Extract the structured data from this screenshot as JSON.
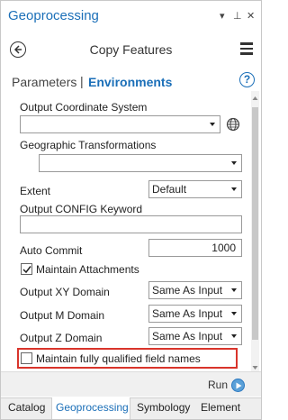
{
  "window": {
    "title": "Geoprocessing",
    "dropdown_glyph": "▾",
    "pin_glyph": "⊥",
    "close_glyph": "✕"
  },
  "header": {
    "tool_title": "Copy Features"
  },
  "tabs": {
    "parameters": "Parameters",
    "separator": "|",
    "environments": "Environments",
    "help": "?"
  },
  "env": {
    "output_coordinate_system": {
      "label": "Output Coordinate System",
      "value": ""
    },
    "geographic_transformations": {
      "label": "Geographic Transformations",
      "value": ""
    },
    "extent": {
      "label": "Extent",
      "value": "Default"
    },
    "output_config_keyword": {
      "label": "Output CONFIG Keyword",
      "value": ""
    },
    "auto_commit": {
      "label": "Auto Commit",
      "value": "1000"
    },
    "maintain_attachments": {
      "label": "Maintain Attachments",
      "checked": true
    },
    "output_xy_domain": {
      "label": "Output XY Domain",
      "value": "Same As Input"
    },
    "output_m_domain": {
      "label": "Output M Domain",
      "value": "Same As Input"
    },
    "output_z_domain": {
      "label": "Output Z Domain",
      "value": "Same As Input"
    },
    "maintain_fully_qualified": {
      "label": "Maintain fully qualified field names",
      "checked": false
    }
  },
  "footer": {
    "run_label": "Run"
  },
  "bottom_tabs": [
    {
      "label": "Catalog",
      "active": false
    },
    {
      "label": "Geoprocessing",
      "active": true
    },
    {
      "label": "Symbology",
      "active": false
    },
    {
      "label": "Element",
      "active": false
    }
  ],
  "colors": {
    "accent": "#1b6fb8",
    "highlight_border": "#d9342b"
  }
}
